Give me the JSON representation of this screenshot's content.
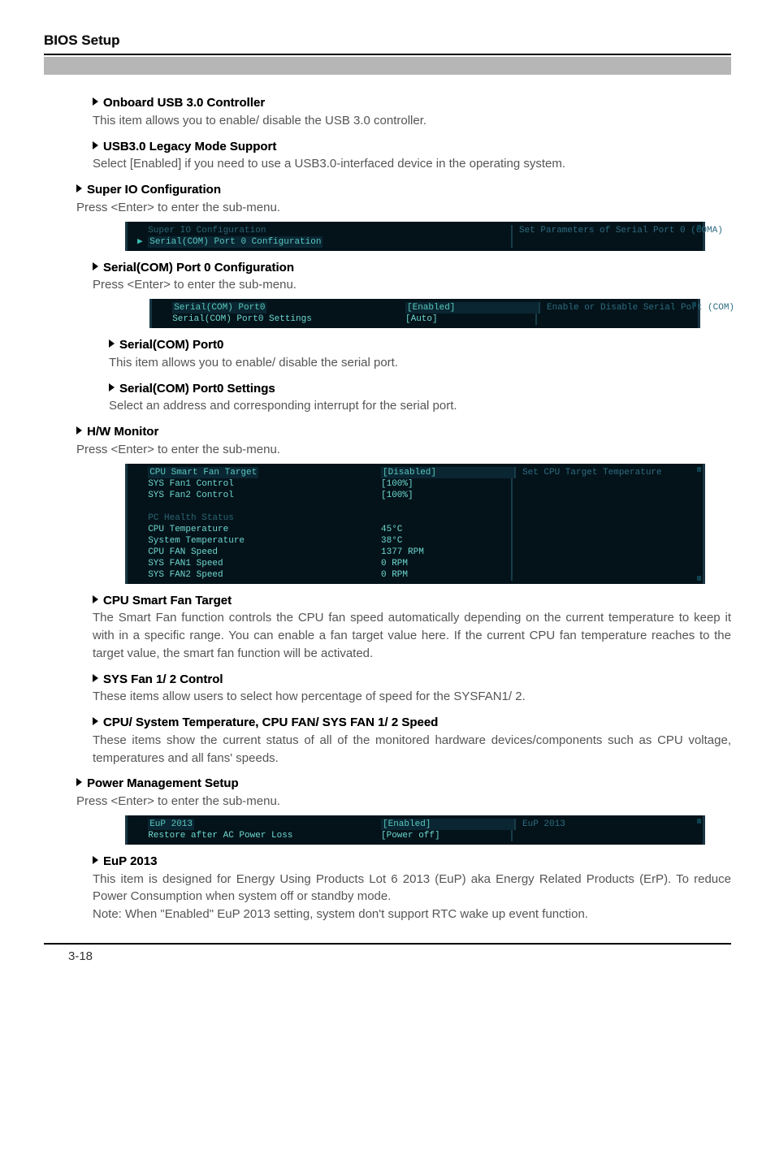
{
  "header": {
    "title": "BIOS Setup"
  },
  "usb30": {
    "title": "Onboard USB 3.0 Controller",
    "desc": "This item allows you to enable/ disable the USB 3.0 controller."
  },
  "usb30legacy": {
    "title": "USB3.0 Legacy Mode Support",
    "desc": "Select [Enabled] if you need to use a USB3.0-interfaced device in the operating system."
  },
  "superio": {
    "title": "Super IO Configuration",
    "enter": "Press <Enter> to enter the sub-menu.",
    "shot": {
      "row0_label": "Super IO Configuration",
      "row1_label": "Serial(COM) Port 0 Configuration",
      "help": "Set Parameters of Serial Port 0 (COMA)"
    }
  },
  "serialcfg": {
    "title": "Serial(COM) Port 0 Configuration",
    "enter": "Press <Enter> to enter the sub-menu.",
    "shot": {
      "r0l": "Serial(COM) Port0",
      "r0v": "[Enabled]",
      "r1l": "Serial(COM) Port0 Settings",
      "r1v": "[Auto]",
      "help": "Enable or Disable Serial Port (COM)"
    }
  },
  "serialport0": {
    "title": "Serial(COM) Port0",
    "desc": "This item allows you to enable/ disable the serial port."
  },
  "serialport0set": {
    "title": "Serial(COM) Port0 Settings",
    "desc": "Select an address and corresponding interrupt for the serial port."
  },
  "hwmon": {
    "title": "H/W Monitor",
    "enter": "Press <Enter> to enter the sub-menu.",
    "shot": {
      "rows": [
        {
          "l": "CPU Smart Fan Target",
          "v": "[Disabled]"
        },
        {
          "l": "SYS Fan1 Control",
          "v": "[100%]"
        },
        {
          "l": "SYS Fan2 Control",
          "v": "[100%]"
        },
        {
          "l": "",
          "v": ""
        },
        {
          "l": "PC Health Status",
          "v": ""
        },
        {
          "l": "CPU Temperature",
          "v": "45°C"
        },
        {
          "l": "System Temperature",
          "v": "38°C"
        },
        {
          "l": "CPU FAN Speed",
          "v": "1377 RPM"
        },
        {
          "l": "SYS FAN1 Speed",
          "v": "0 RPM"
        },
        {
          "l": "SYS FAN2 Speed",
          "v": "0 RPM"
        }
      ],
      "help": "Set CPU Target Temperature"
    }
  },
  "cpusmart": {
    "title": "CPU Smart Fan Target",
    "desc": "The Smart Fan function controls the CPU fan speed automatically depending on the current temperature to keep it with in a specific range.  You can enable a fan target value here. If the current CPU fan temperature reaches to the target value, the smart fan function will be activated."
  },
  "sysfan12": {
    "title": "SYS Fan 1/ 2 Control",
    "desc": "These items allow users to select how percentage of speed for the SYSFAN1/ 2."
  },
  "tempspeed": {
    "title": "CPU/ System Temperature, CPU FAN/ SYS FAN 1/ 2 Speed",
    "desc": "These items show the current status of all of the monitored hardware devices/components such as CPU voltage, temperatures and all fans' speeds."
  },
  "power": {
    "title": "Power Management Setup",
    "enter": "Press <Enter> to enter the sub-menu.",
    "shot": {
      "r0l": "EuP 2013",
      "r0v": "[Enabled]",
      "r1l": "Restore after AC Power Loss",
      "r1v": "[Power off]",
      "help": "EuP 2013"
    }
  },
  "eup": {
    "title": "EuP 2013",
    "desc": "This item is designed for Energy Using Products Lot 6 2013 (EuP) aka Energy Related Products (ErP). To reduce Power Consumption when system off or standby mode.",
    "note": "Note: When \"Enabled\" EuP 2013 setting, system don't support RTC wake up event function."
  },
  "footer": {
    "page": "3-18"
  }
}
